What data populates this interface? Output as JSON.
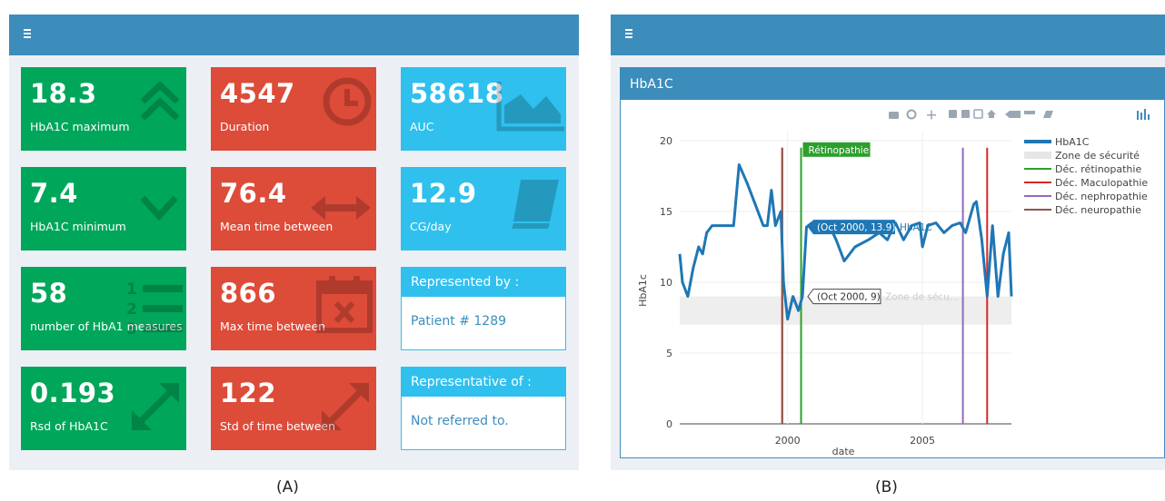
{
  "panel_a": {
    "caption": "(A)",
    "boxes": [
      {
        "value": "18.3",
        "label": "HbA1C maximum",
        "color": "#00a65a",
        "icon": "double-chevron-up-icon"
      },
      {
        "value": "4547",
        "label": "Duration",
        "color": "#dd4b39",
        "icon": "clock-icon"
      },
      {
        "value": "58618",
        "label": "AUC",
        "color": "#2fc0ee",
        "icon": "area-chart-icon"
      },
      {
        "value": "7.4",
        "label": "HbA1C minimum",
        "color": "#00a65a",
        "icon": "chevron-down-icon"
      },
      {
        "value": "76.4",
        "label": "Mean time between",
        "color": "#dd4b39",
        "icon": "horizontal-arrows-icon"
      },
      {
        "value": "12.9",
        "label": "CG/day",
        "color": "#2fc0ee",
        "icon": "book-icon"
      },
      {
        "value": "58",
        "label": "number of HbA1 measures",
        "color": "#00a65a",
        "icon": "ordered-list-icon"
      },
      {
        "value": "866",
        "label": "Max time between",
        "color": "#dd4b39",
        "icon": "calendar-x-icon"
      },
      {
        "value": "0.193",
        "label": "Rsd of HbA1C",
        "color": "#00a65a",
        "icon": "expand-arrows-icon"
      },
      {
        "value": "122",
        "label": "Std of time between",
        "color": "#dd4b39",
        "icon": "expand-arrows-icon"
      }
    ],
    "represented_by": {
      "title": "Represented by :",
      "value": "Patient # 1289"
    },
    "representative_of": {
      "title": "Representative of :",
      "value": "Not referred to."
    }
  },
  "panel_b": {
    "caption": "(B)",
    "box_title": "HbA1C",
    "chart_data": {
      "type": "line",
      "xlabel": "date",
      "ylabel": "HbA1c",
      "xlim": [
        1996.0,
        2008.3
      ],
      "ylim": [
        0,
        20
      ],
      "x_ticks": [
        2000,
        2005
      ],
      "y_ticks": [
        0,
        5,
        10,
        15,
        20
      ],
      "grid": true,
      "legend_placement": "top-right",
      "safety_zone": {
        "name": "Zone de sécurité",
        "y_range": [
          7,
          9
        ],
        "color": "#eeeeee"
      },
      "series": [
        {
          "name": "HbA1C",
          "color": "#1f77b4",
          "x": [
            1996.0,
            1996.1,
            1996.3,
            1996.5,
            1996.7,
            1996.85,
            1997.0,
            1997.2,
            1997.4,
            1997.7,
            1998.0,
            1998.2,
            1998.5,
            1998.8,
            1999.1,
            1999.25,
            1999.4,
            1999.55,
            1999.75,
            1999.85,
            2000.0,
            2000.2,
            2000.4,
            2000.55,
            2000.7,
            2000.9,
            2001.3,
            2001.6,
            2001.8,
            2002.1,
            2002.5,
            2003.0,
            2003.4,
            2003.7,
            2004.0,
            2004.3,
            2004.6,
            2004.9,
            2005.0,
            2005.2,
            2005.5,
            2005.8,
            2006.1,
            2006.4,
            2006.6,
            2006.9,
            2007.0,
            2007.2,
            2007.4,
            2007.6,
            2007.8,
            2008.0,
            2008.2,
            2008.3
          ],
          "y": [
            12.0,
            10.0,
            9.0,
            11.0,
            12.5,
            12.0,
            13.5,
            14.0,
            14.0,
            14.0,
            14.0,
            18.3,
            17.0,
            15.5,
            14.0,
            14.0,
            16.5,
            14.0,
            15.0,
            10.0,
            7.4,
            9.0,
            8.0,
            9.0,
            13.9,
            14.2,
            13.5,
            13.8,
            13.0,
            11.5,
            12.5,
            13.0,
            13.5,
            13.0,
            14.2,
            13.0,
            14.0,
            14.2,
            12.5,
            14.0,
            14.2,
            13.5,
            14.0,
            14.2,
            13.5,
            15.5,
            15.7,
            13.0,
            9.0,
            14.0,
            9.0,
            12.0,
            13.5,
            9.0
          ]
        },
        {
          "name": "Déc. rétinopathie",
          "color": "#2ca02c",
          "x_line": 2000.5
        },
        {
          "name": "Déc. Maculopathie",
          "color": "#d62728",
          "x_line": [
            1999.8,
            2007.4
          ]
        },
        {
          "name": "Déc. nephropathie",
          "color": "#9467bd",
          "x_line": 2006.5
        },
        {
          "name": "Déc. neuropathie",
          "color": "#8c564b",
          "x_line": 1999.8
        }
      ],
      "annotations": [
        {
          "text": "Rétinopathie",
          "x": 2000.5,
          "y": 19.5,
          "color": "#2ca02c"
        },
        {
          "text": "(Oct 2000, 13.9)",
          "series_label": "HbA1C",
          "x": 2000.75,
          "y": 13.9,
          "color": "#1f77b4"
        },
        {
          "text": "(Oct 2000, 9)",
          "series_label": "Zone de sécu...",
          "x": 2000.75,
          "y": 9,
          "color": "#ffffff"
        }
      ]
    },
    "legend": [
      {
        "label": "HbA1C",
        "color": "#1f77b4"
      },
      {
        "label": "Zone de sécurité",
        "color": "#e6e6e6"
      },
      {
        "label": "Déc. rétinopathie",
        "color": "#2ca02c"
      },
      {
        "label": "Déc. Maculopathie",
        "color": "#d62728"
      },
      {
        "label": "Déc. nephropathie",
        "color": "#9467bd"
      },
      {
        "label": "Déc. neuropathie",
        "color": "#8c564b"
      }
    ]
  }
}
